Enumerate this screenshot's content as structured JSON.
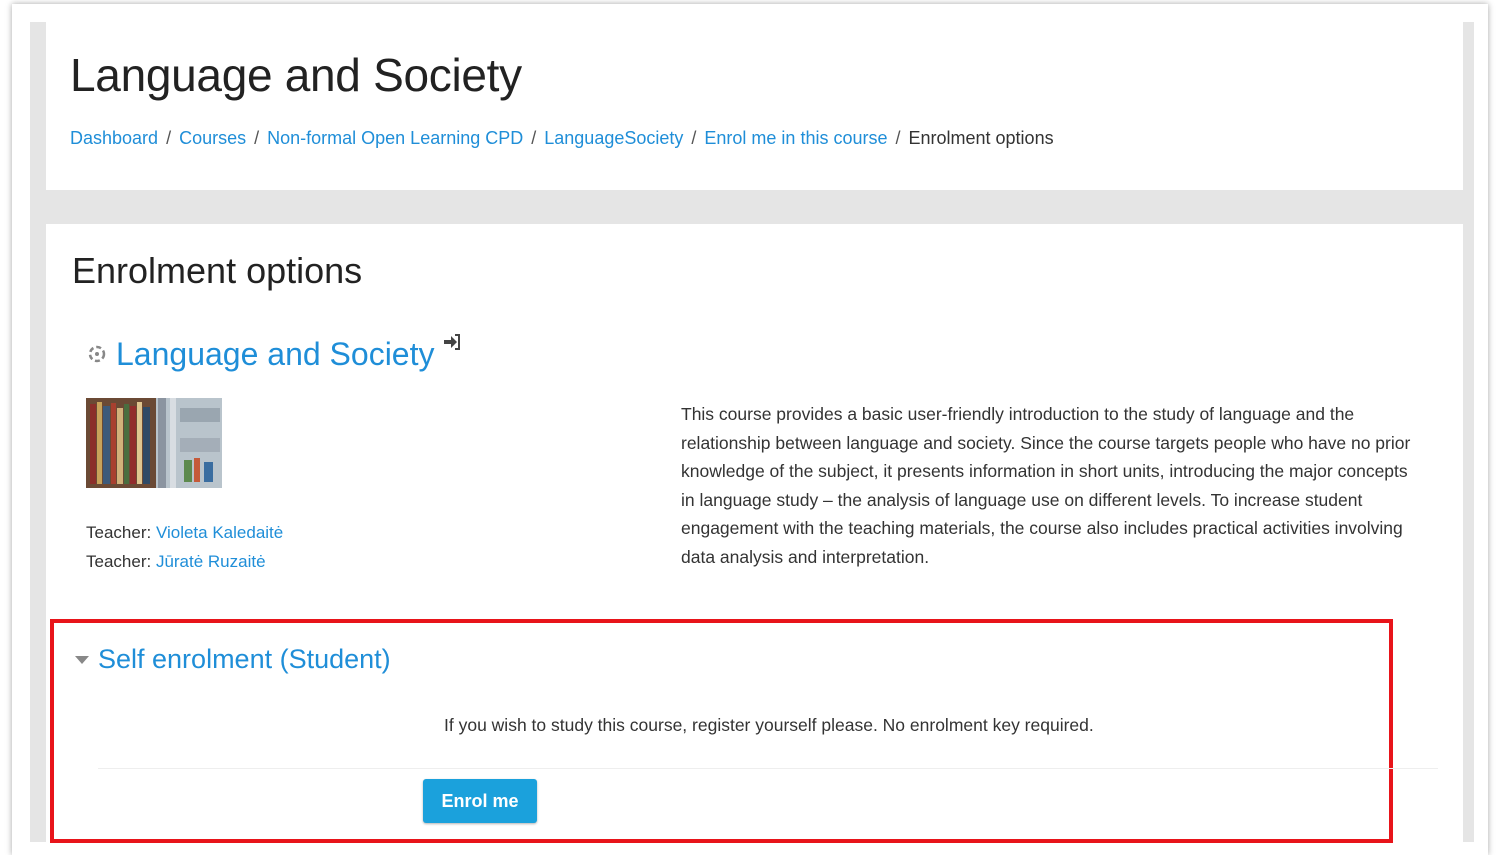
{
  "header": {
    "title": "Language and Society",
    "breadcrumb": {
      "items": [
        {
          "label": "Dashboard"
        },
        {
          "label": "Courses"
        },
        {
          "label": "Non-formal Open Learning CPD"
        },
        {
          "label": "LanguageSociety"
        },
        {
          "label": "Enrol me in this course"
        }
      ],
      "current": "Enrolment options",
      "separator": "/"
    }
  },
  "main": {
    "section_title": "Enrolment options",
    "course": {
      "name": "Language and Society",
      "icon": "course-category-icon",
      "enrol_icon": "enrol-arrow-icon",
      "image": "bookshelf-image",
      "teachers": [
        {
          "role": "Teacher: ",
          "name": "Violeta Kaledaitė"
        },
        {
          "role": "Teacher: ",
          "name": "Jūratė Ruzaitė"
        }
      ],
      "summary": "This course provides a basic user-friendly introduction to the study of language and the relationship between language and society. Since the course targets people who have no prior knowledge of the subject, it presents information in short units, introducing the major concepts in language study – the analysis of language use on different levels. To increase student engagement with the teaching materials, the course also includes practical activities involving data analysis and interpretation."
    },
    "self_enrolment": {
      "title": "Self enrolment (Student)",
      "message": "If you wish to study this course, register yourself please. No enrolment key required.",
      "button_label": "Enrol me"
    }
  },
  "colors": {
    "link": "#1f8ed8",
    "button": "#1ba1dc",
    "highlight_border": "#e8141a",
    "page_background": "#e5e5e5"
  }
}
